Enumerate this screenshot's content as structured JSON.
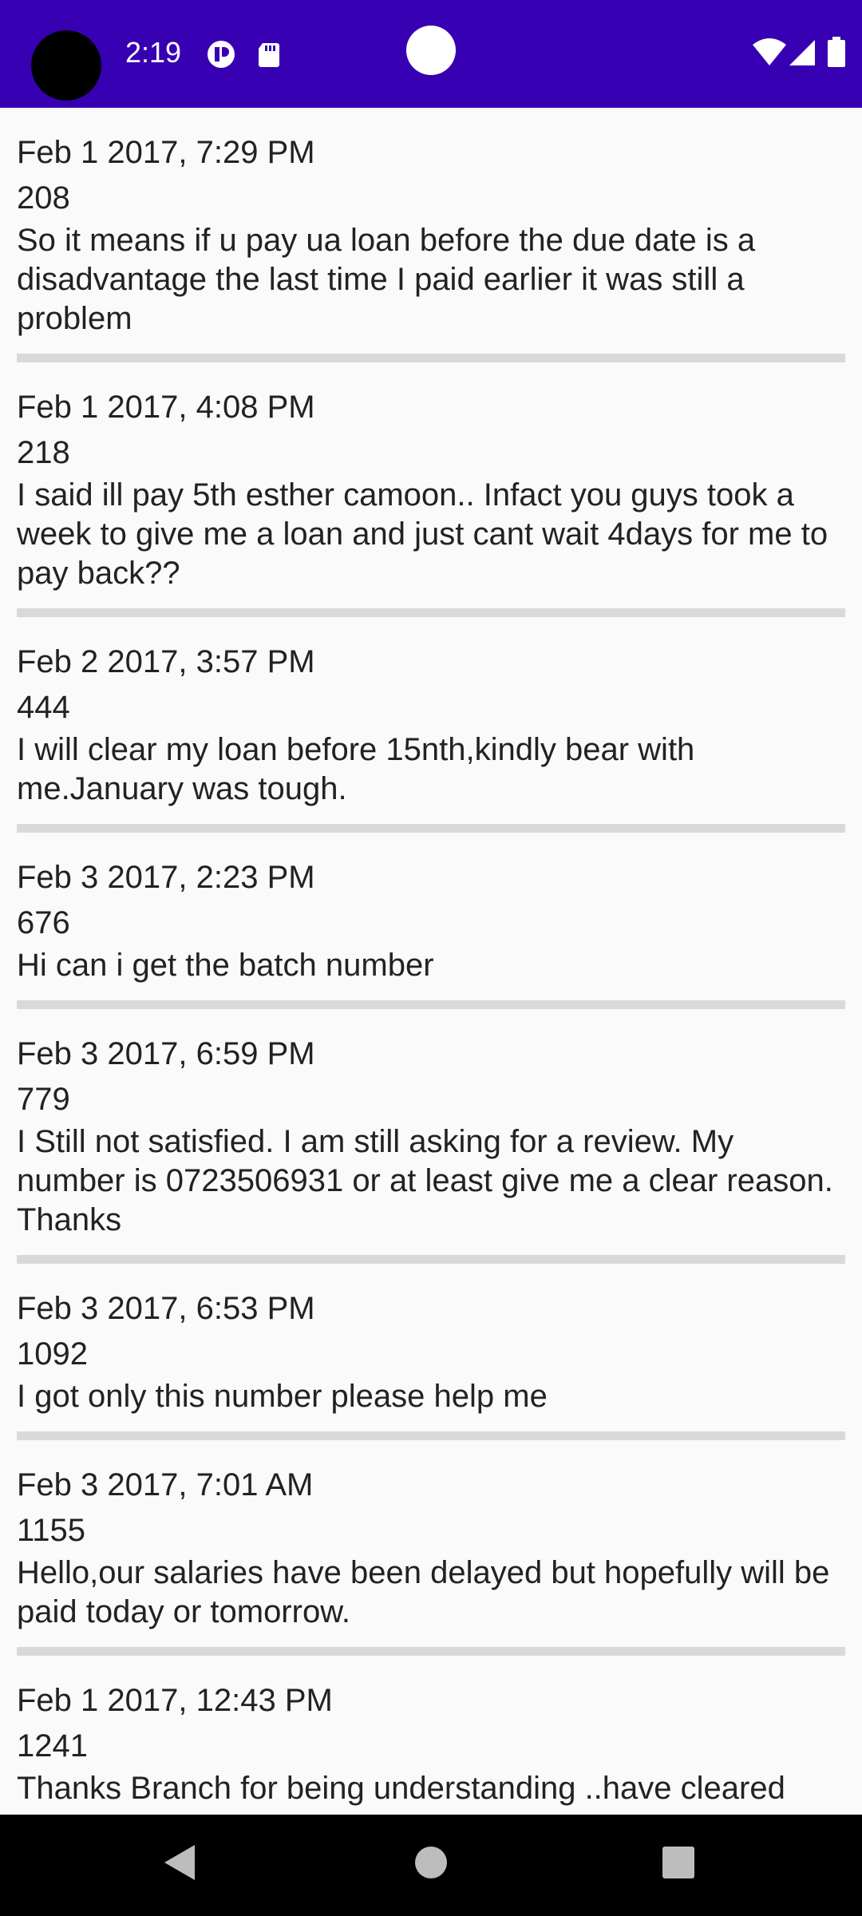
{
  "status_bar": {
    "time": "2:19",
    "icons_left": [
      "app-notification-icon",
      "sd-card-icon"
    ],
    "icons_right": [
      "wifi-icon",
      "cell-signal-icon",
      "battery-icon"
    ],
    "background_color": "#3700b3"
  },
  "messages": [
    {
      "date": "Feb 1 2017, 7:29 PM",
      "id": "208",
      "text": "So it means if u pay ua loan before the due date is a disadvantage the last time I paid earlier it was still a problem"
    },
    {
      "date": "Feb 1 2017, 4:08 PM",
      "id": "218",
      "text": "I said ill pay 5th esther camoon.. Infact you guys took a week to give me a loan and just cant wait 4days for me to pay back??"
    },
    {
      "date": "Feb 2 2017, 3:57 PM",
      "id": "444",
      "text": "I will clear my loan before 15nth,kindly bear with me.January was tough."
    },
    {
      "date": "Feb 3 2017, 2:23 PM",
      "id": "676",
      "text": "Hi can i get the batch number"
    },
    {
      "date": "Feb 3 2017, 6:59 PM",
      "id": "779",
      "text": "I Still not satisfied. I am still asking for a review.  My number is 0723506931 or at least give me a clear reason.  Thanks"
    },
    {
      "date": "Feb 3 2017, 6:53 PM",
      "id": "1092",
      "text": "I got only this number please help me"
    },
    {
      "date": "Feb 3 2017, 7:01 AM",
      "id": "1155",
      "text": "Hello,our salaries have been delayed but hopefully will be paid today or tomorrow."
    },
    {
      "date": "Feb 1 2017, 12:43 PM",
      "id": "1241",
      "text": "Thanks Branch for being understanding ..have cleared"
    }
  ],
  "nav_bar": {
    "buttons": [
      "back-icon",
      "home-icon",
      "recents-icon"
    ]
  }
}
